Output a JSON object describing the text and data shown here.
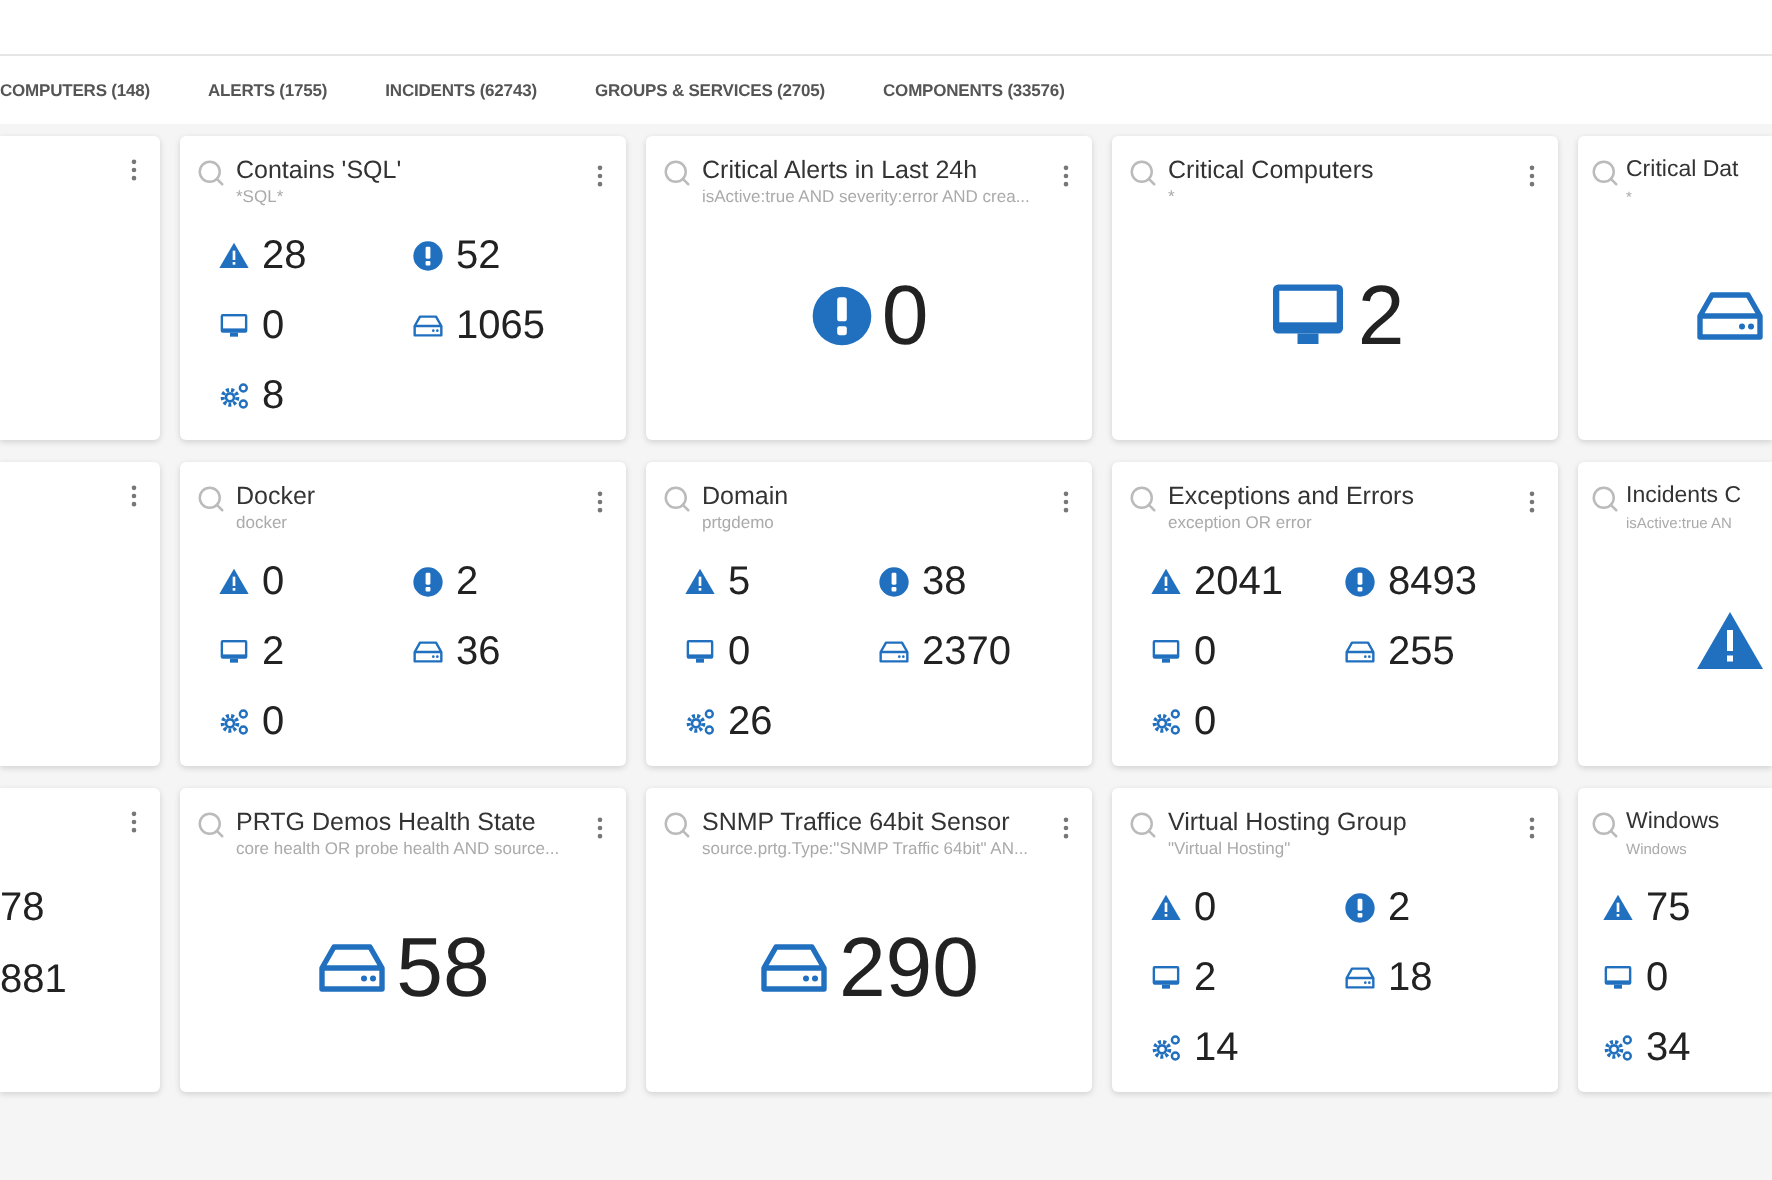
{
  "tabs": [
    {
      "label": "COMPUTERS (148)"
    },
    {
      "label": "ALERTS (1755)"
    },
    {
      "label": "INCIDENTS (62743)"
    },
    {
      "label": "GROUPS & SERVICES (2705)"
    },
    {
      "label": "COMPONENTS (33576)"
    }
  ],
  "cards": [
    {
      "kind": "fragment"
    },
    {
      "kind": "summary",
      "title": "Contains 'SQL'",
      "query": "*SQL*",
      "stats": [
        {
          "kind": "alert",
          "value": "28"
        },
        {
          "kind": "incident",
          "value": "52"
        },
        {
          "kind": "computer",
          "value": "0"
        },
        {
          "kind": "sensor",
          "value": "1065"
        },
        {
          "kind": "component",
          "value": "8"
        }
      ]
    },
    {
      "kind": "single",
      "title": "Critical Alerts in Last 24h",
      "query": "isActive:true AND severity:error AND crea...",
      "stat": {
        "kind": "incident",
        "value": "0"
      }
    },
    {
      "kind": "single",
      "title": "Critical Computers",
      "query": "*",
      "stat": {
        "kind": "computer",
        "value": "2"
      }
    },
    {
      "kind": "single",
      "title": "Critical Dat",
      "query": "*",
      "stat": {
        "kind": "sensor"
      }
    },
    {
      "kind": "fragment"
    },
    {
      "kind": "summary",
      "title": "Docker",
      "query": "docker",
      "stats": [
        {
          "kind": "alert",
          "value": "0"
        },
        {
          "kind": "incident",
          "value": "2"
        },
        {
          "kind": "computer",
          "value": "2"
        },
        {
          "kind": "sensor",
          "value": "36"
        },
        {
          "kind": "component",
          "value": "0"
        }
      ]
    },
    {
      "kind": "summary",
      "title": "Domain",
      "query": "prtgdemo",
      "stats": [
        {
          "kind": "alert",
          "value": "5"
        },
        {
          "kind": "incident",
          "value": "38"
        },
        {
          "kind": "computer",
          "value": "0"
        },
        {
          "kind": "sensor",
          "value": "2370"
        },
        {
          "kind": "component",
          "value": "26"
        }
      ]
    },
    {
      "kind": "summary",
      "title": "Exceptions and Errors",
      "query": "exception OR error",
      "stats": [
        {
          "kind": "alert",
          "value": "2041"
        },
        {
          "kind": "incident",
          "value": "8493"
        },
        {
          "kind": "computer",
          "value": "0"
        },
        {
          "kind": "sensor",
          "value": "255"
        },
        {
          "kind": "component",
          "value": "0"
        }
      ]
    },
    {
      "kind": "single",
      "title": "Incidents C",
      "query": "isActive:true AN",
      "stat": {
        "kind": "alert"
      }
    },
    {
      "kind": "fragment",
      "values": [
        "78",
        "881"
      ]
    },
    {
      "kind": "single",
      "title": "PRTG Demos Health State",
      "query": "core health OR probe health AND source...",
      "stat": {
        "kind": "sensor",
        "value": "58"
      }
    },
    {
      "kind": "single",
      "title": "SNMP Traffice 64bit Sensor",
      "query": "source.prtg.Type:\"SNMP Traffic 64bit\" AN...",
      "stat": {
        "kind": "sensor",
        "value": "290"
      }
    },
    {
      "kind": "summary",
      "title": "Virtual Hosting Group",
      "query": "\"Virtual Hosting\"",
      "stats": [
        {
          "kind": "alert",
          "value": "0"
        },
        {
          "kind": "incident",
          "value": "2"
        },
        {
          "kind": "computer",
          "value": "2"
        },
        {
          "kind": "sensor",
          "value": "18"
        },
        {
          "kind": "component",
          "value": "14"
        }
      ]
    },
    {
      "kind": "summary",
      "title": "Windows",
      "query": "Windows",
      "stats": [
        {
          "kind": "alert",
          "value": "75"
        },
        {
          "kind": "computer",
          "value": "0"
        },
        {
          "kind": "component",
          "value": "34"
        }
      ]
    }
  ]
}
